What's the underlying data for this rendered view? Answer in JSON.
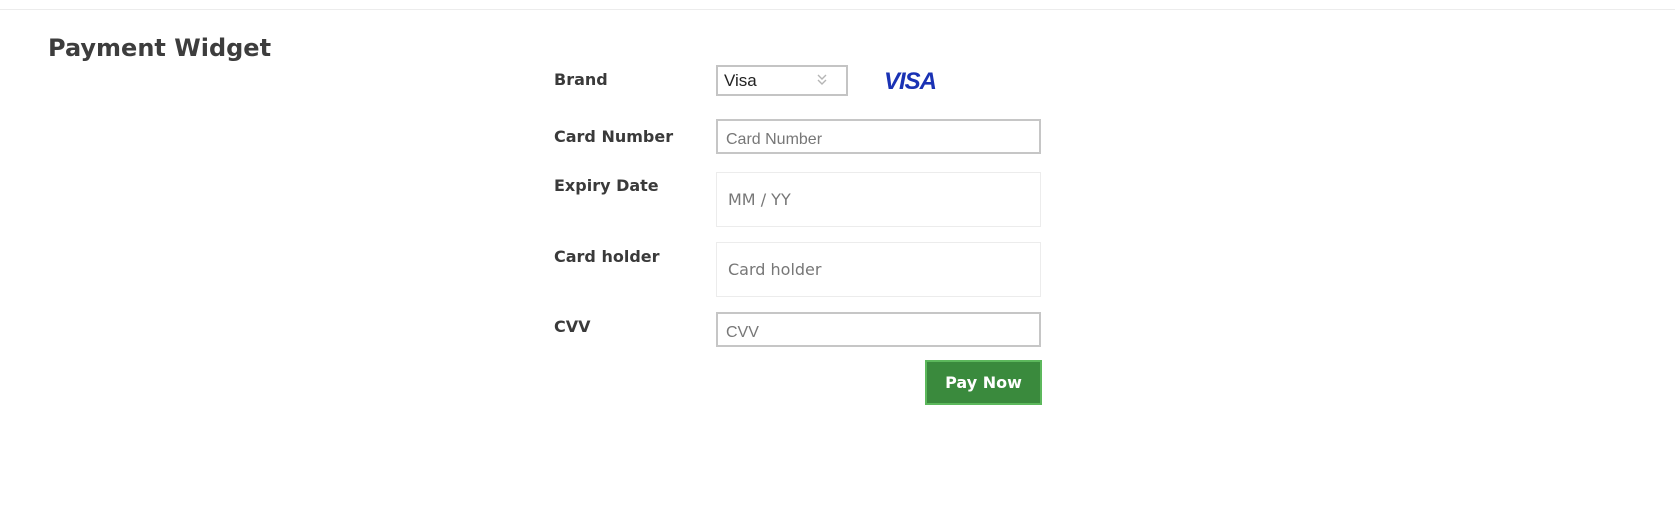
{
  "page": {
    "title": "Payment Widget"
  },
  "form": {
    "brand": {
      "label": "Brand",
      "selected": "Visa",
      "logo_text": "VISA",
      "logo_color": "#1a32b4"
    },
    "card_number": {
      "label": "Card Number",
      "value": "",
      "placeholder": "Card Number"
    },
    "expiry_date": {
      "label": "Expiry Date",
      "value": "",
      "placeholder": "MM / YY"
    },
    "card_holder": {
      "label": "Card holder",
      "value": "",
      "placeholder": "Card holder"
    },
    "cvv": {
      "label": "CVV",
      "value": "",
      "placeholder": "CVV"
    },
    "submit": {
      "label": "Pay Now",
      "color": "#3a8a3d"
    }
  },
  "icons": {
    "select_indicator": "chevron-down-icon"
  }
}
